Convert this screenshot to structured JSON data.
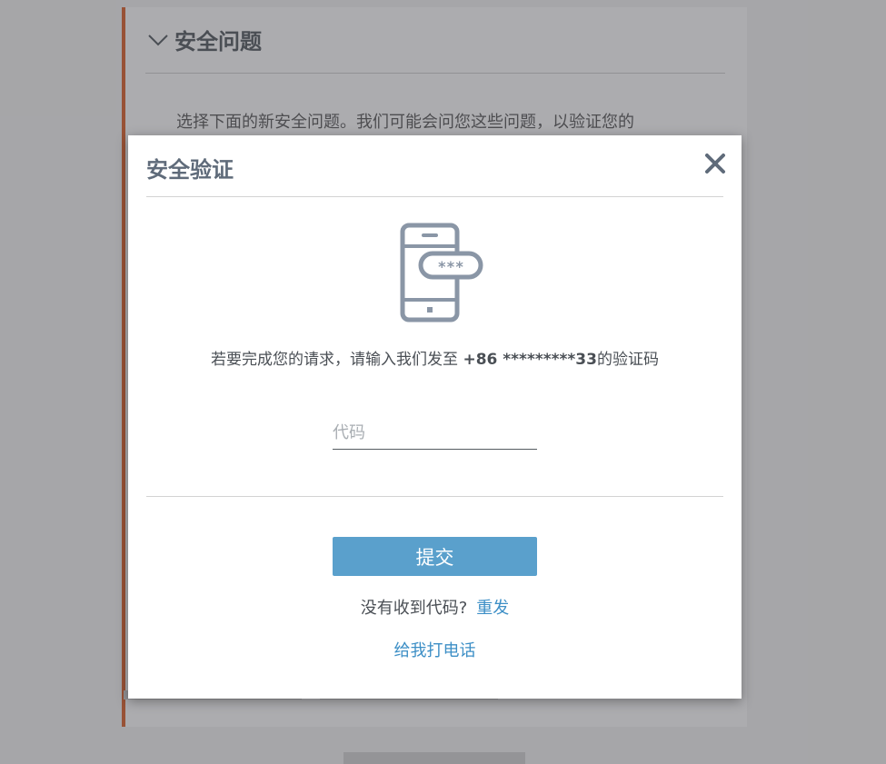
{
  "background": {
    "section_title": "安全问题",
    "section_text": "选择下面的新安全问题。我们可能会问您这些问题，以验证您的"
  },
  "dialog": {
    "title": "安全验证",
    "message_prefix": "若要完成您的请求，请输入我们发至 ",
    "phone_masked": "+86 *********33",
    "message_suffix": "的验证码",
    "code_placeholder": "代码",
    "code_value": "",
    "submit_label": "提交",
    "no_code_text": "没有收到代码?",
    "resend_label": "重发",
    "call_me_label": "给我打电话"
  },
  "colors": {
    "accent": "#5aa0cc",
    "link": "#3d8fc6",
    "panel_border": "#d64b0c",
    "icon": "#8a96a6"
  },
  "icons": {
    "close": "close-icon",
    "phone": "phone-password-icon",
    "chevron": "chevron-down-icon"
  }
}
